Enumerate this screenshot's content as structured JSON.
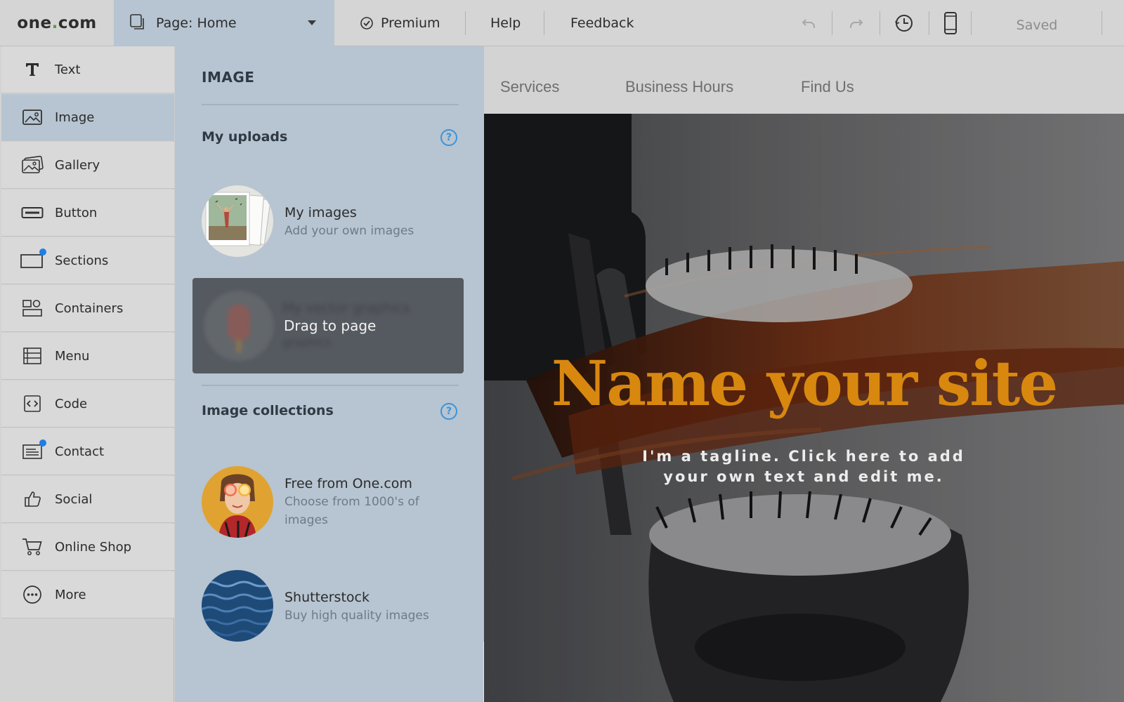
{
  "app": {
    "logo_text_a": "one",
    "logo_text_dot": ".",
    "logo_text_b": "com"
  },
  "topbar": {
    "page_selector": "Page: Home",
    "premium": "Premium",
    "help": "Help",
    "feedback": "Feedback",
    "status": "Saved",
    "icons": [
      "undo-icon",
      "redo-icon",
      "history-icon",
      "mobile-preview-icon"
    ]
  },
  "tools": [
    {
      "label": "Text",
      "icon": "text-icon"
    },
    {
      "label": "Image",
      "icon": "image-icon",
      "active": true
    },
    {
      "label": "Gallery",
      "icon": "gallery-icon"
    },
    {
      "label": "Button",
      "icon": "button-icon"
    },
    {
      "label": "Sections",
      "icon": "sections-icon",
      "badge": true
    },
    {
      "label": "Containers",
      "icon": "containers-icon"
    },
    {
      "label": "Menu",
      "icon": "menu-icon"
    },
    {
      "label": "Code",
      "icon": "code-icon"
    },
    {
      "label": "Contact",
      "icon": "contact-icon",
      "badge": true
    },
    {
      "label": "Social",
      "icon": "thumbs-up-icon"
    },
    {
      "label": "Online Shop",
      "icon": "cart-icon"
    },
    {
      "label": "More",
      "icon": "more-icon"
    }
  ],
  "panel": {
    "title": "IMAGE",
    "uploads_heading": "My uploads",
    "my_images": {
      "name": "My images",
      "desc": "Add your own images"
    },
    "drag_overlay": "Drag to page",
    "vector_ghost": {
      "name": "My vector graphics",
      "desc": "graphics"
    },
    "collections_heading": "Image collections",
    "free": {
      "name": "Free from One.com",
      "desc": "Choose from 1000's of images"
    },
    "shutterstock": {
      "name": "Shutterstock",
      "desc": "Buy high quality images"
    },
    "help_glyph": "?"
  },
  "site": {
    "nav": [
      "Services",
      "Business Hours",
      "Find Us"
    ],
    "hero_title": "Name your site",
    "hero_tagline": "I'm a tagline. Click here to add your own text and edit me."
  },
  "colors": {
    "accent": "#b7c4d1",
    "title": "#d8880f",
    "help": "#3b94d9",
    "badge": "#1e7ee6"
  }
}
